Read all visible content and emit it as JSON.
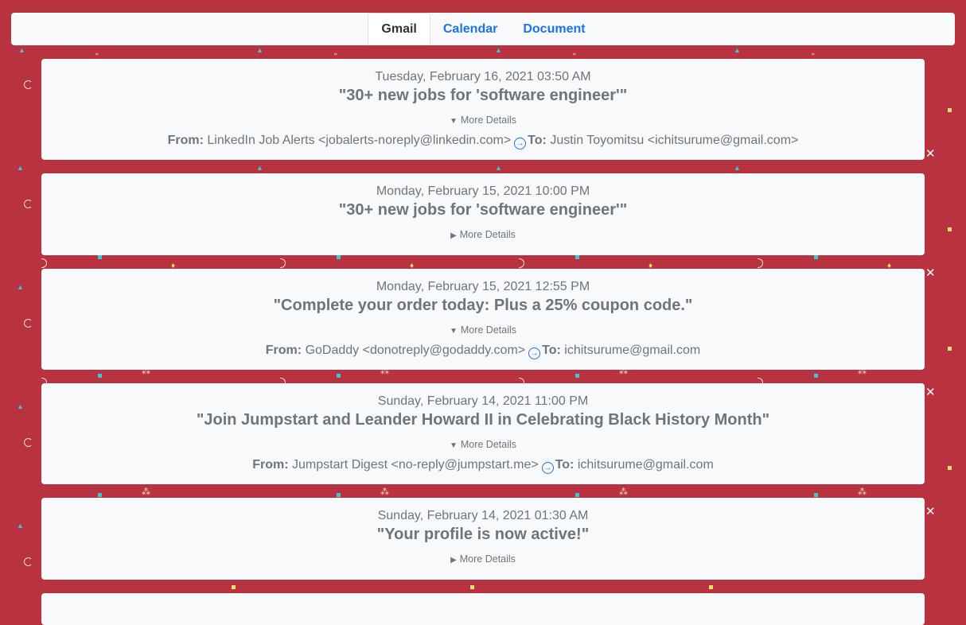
{
  "tabs": [
    {
      "label": "Gmail"
    },
    {
      "label": "Calendar"
    },
    {
      "label": "Document"
    }
  ],
  "labels": {
    "from": "From:",
    "to": "To:",
    "more_details": "More Details"
  },
  "emails": [
    {
      "date": "Tuesday, February 16, 2021 03:50 AM",
      "subject": "\"30+ new jobs for 'software engineer'\"",
      "expanded": true,
      "from": "LinkedIn Job Alerts <jobalerts-noreply@linkedin.com>",
      "to": "Justin Toyomitsu <ichitsurume@gmail.com>"
    },
    {
      "date": "Monday, February 15, 2021 10:00 PM",
      "subject": "\"30+ new jobs for 'software engineer'\"",
      "expanded": false
    },
    {
      "date": "Monday, February 15, 2021 12:55 PM",
      "subject": "\"Complete your order today: Plus a 25% coupon code.\"",
      "expanded": true,
      "from": "GoDaddy <donotreply@godaddy.com>",
      "to": "ichitsurume@gmail.com"
    },
    {
      "date": "Sunday, February 14, 2021 11:00 PM",
      "subject": "\"Join Jumpstart and Leander Howard II in Celebrating Black History Month\"",
      "expanded": true,
      "from": "Jumpstart Digest <no-reply@jumpstart.me>",
      "to": "ichitsurume@gmail.com"
    },
    {
      "date": "Sunday, February 14, 2021 01:30 AM",
      "subject": "\"Your profile is now active!\"",
      "expanded": false
    }
  ],
  "icons": {
    "close": "close-icon",
    "send": "arrow-right-circle-icon",
    "expand": "triangle-icon"
  },
  "colors": {
    "background": "#b83240",
    "card": "#f8f9fa",
    "link": "#1a73e8",
    "text": "#6c757d"
  }
}
